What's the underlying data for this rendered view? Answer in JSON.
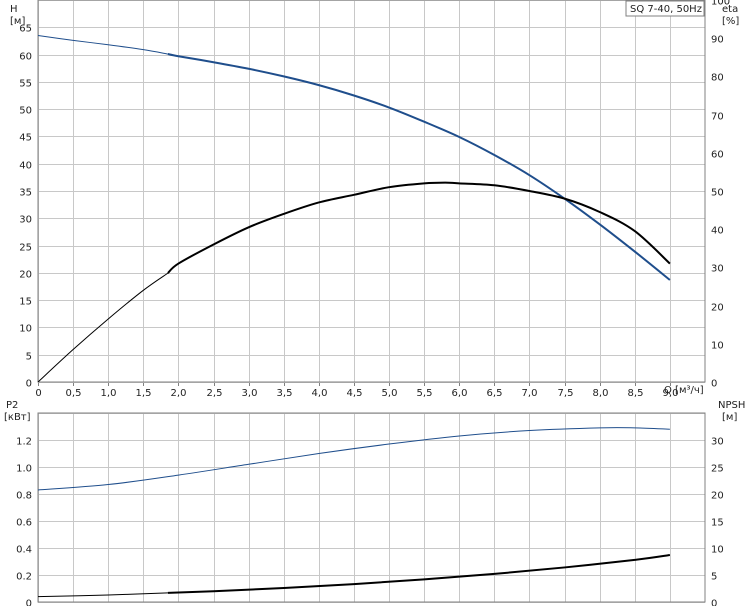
{
  "chart_data": [
    {
      "type": "line",
      "legend_box": "SQ 7-40, 50Hz",
      "ylabel_left": "H",
      "yunit_left": "[м]",
      "ylabel_right": "eta",
      "yunit_right": "[%]",
      "xlabel": "Q [м³/ч]",
      "xlim": [
        0,
        9.5
      ],
      "ylim_left": [
        0,
        70
      ],
      "ylim_right": [
        0,
        100
      ],
      "x_ticks": [
        "0",
        "0,5",
        "1,0",
        "1,5",
        "2,0",
        "2,5",
        "3,0",
        "3,5",
        "4,0",
        "4,5",
        "5,0",
        "5,5",
        "6,0",
        "6,5",
        "7,0",
        "7,5",
        "8,0",
        "8,5",
        "9,0"
      ],
      "y_ticks_left": [
        "0",
        "5",
        "10",
        "15",
        "20",
        "25",
        "30",
        "35",
        "40",
        "45",
        "50",
        "55",
        "60",
        "65"
      ],
      "y_ticks_right": [
        "0",
        "10",
        "20",
        "30",
        "40",
        "50",
        "60",
        "70",
        "80",
        "90",
        "100"
      ],
      "grid": true,
      "series": [
        {
          "key": "head",
          "axis": "left",
          "color": "#1f4e8c",
          "thin_until": 1.85,
          "x": [
            0,
            0.5,
            1.0,
            1.5,
            1.85,
            2.0,
            2.5,
            3.0,
            3.5,
            4.0,
            4.5,
            5.0,
            5.5,
            6.0,
            6.5,
            7.0,
            7.5,
            8.0,
            8.5,
            9.0
          ],
          "y": [
            63.5,
            62.6,
            61.8,
            60.9,
            60.1,
            59.7,
            58.6,
            57.4,
            56.0,
            54.4,
            52.5,
            50.3,
            47.7,
            44.9,
            41.6,
            37.9,
            33.6,
            28.9,
            23.9,
            18.7
          ]
        },
        {
          "key": "eta",
          "axis": "right",
          "color": "#000000",
          "thin_until": 1.85,
          "x": [
            0,
            0.5,
            1.0,
            1.5,
            1.85,
            2.0,
            2.5,
            3.0,
            3.5,
            4.0,
            4.5,
            5.0,
            5.5,
            5.8,
            6.0,
            6.5,
            7.0,
            7.5,
            8.0,
            8.5,
            9.0
          ],
          "y": [
            0,
            8.5,
            16.5,
            24.0,
            28.5,
            31.0,
            36.0,
            40.5,
            44.0,
            47.0,
            49.0,
            51.0,
            52.0,
            52.2,
            52.0,
            51.5,
            50.0,
            48.0,
            44.5,
            39.5,
            31.0
          ]
        }
      ]
    },
    {
      "type": "line",
      "ylabel_left": "P2",
      "yunit_left": "[кВт]",
      "ylabel_right": "NPSH",
      "yunit_right": "[м]",
      "xlim": [
        0,
        9.5
      ],
      "ylim_left": [
        0,
        1.4
      ],
      "ylim_right": [
        0,
        35
      ],
      "y_ticks_left": [
        "0",
        "0.2",
        "0.4",
        "0.6",
        "0.8",
        "1.0",
        "1.2"
      ],
      "y_ticks_right": [
        "0",
        "5",
        "10",
        "15",
        "20",
        "25",
        "30"
      ],
      "grid": true,
      "series": [
        {
          "key": "p2",
          "axis": "left",
          "color": "#1f4e8c",
          "thin_until": 9.0,
          "x": [
            0,
            1.0,
            2.0,
            3.0,
            4.0,
            5.0,
            6.0,
            7.0,
            8.0,
            8.5,
            9.0
          ],
          "y": [
            0.83,
            0.87,
            0.94,
            1.02,
            1.1,
            1.17,
            1.23,
            1.27,
            1.29,
            1.29,
            1.28
          ]
        },
        {
          "key": "npsh",
          "axis": "right",
          "color": "#000000",
          "thin_until": 1.85,
          "x": [
            0,
            1.0,
            1.85,
            2.5,
            3.5,
            4.5,
            5.5,
            6.5,
            7.5,
            8.5,
            9.0
          ],
          "y": [
            1.0,
            1.3,
            1.7,
            2.0,
            2.6,
            3.3,
            4.2,
            5.2,
            6.4,
            7.8,
            8.7
          ]
        }
      ]
    }
  ]
}
